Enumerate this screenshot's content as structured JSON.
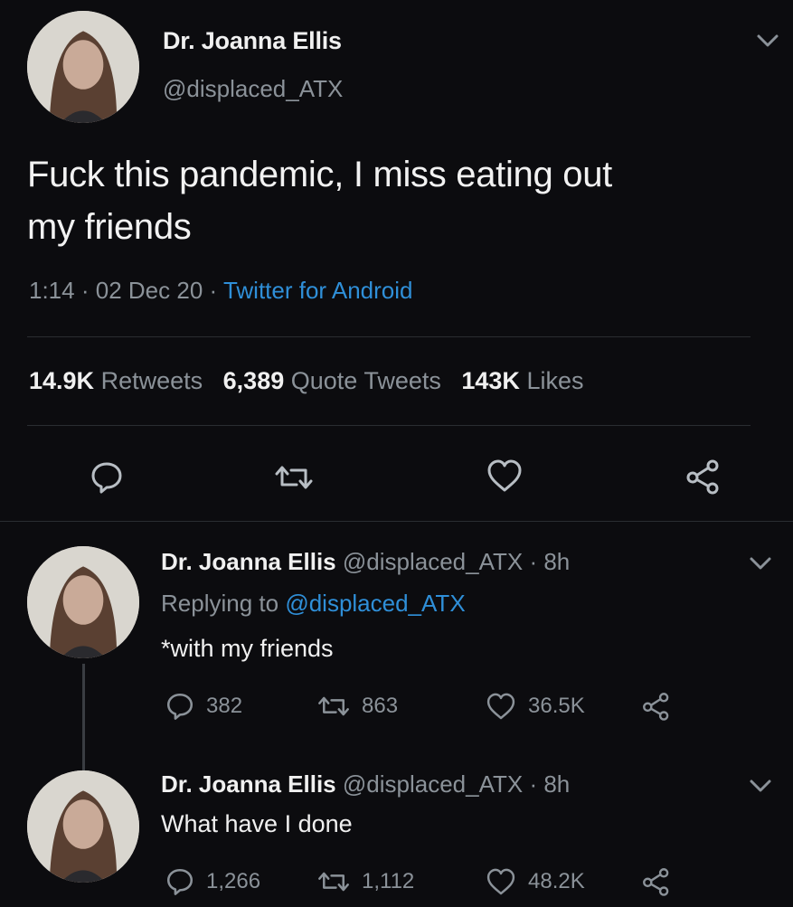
{
  "main_tweet": {
    "name": "Dr. Joanna Ellis",
    "handle": "@displaced_ATX",
    "text_line1": "Fuck this pandemic, I miss eating out",
    "text_line2": "my friends",
    "time": "1:14",
    "date": "02 Dec 20",
    "sep": "·",
    "source": "Twitter for Android",
    "retweets_count": "14.9K",
    "retweets_label": "Retweets",
    "quotes_count": "6,389",
    "quotes_label": "Quote Tweets",
    "likes_count": "143K",
    "likes_label": "Likes"
  },
  "replies": [
    {
      "name": "Dr. Joanna Ellis",
      "handle": "@displaced_ATX",
      "time": "· 8h",
      "replying_label": "Replying to",
      "replying_to": "@displaced_ATX",
      "text": "*with my friends",
      "reply_count": "382",
      "retweet_count": "863",
      "like_count": "36.5K"
    },
    {
      "name": "Dr. Joanna Ellis",
      "handle": "@displaced_ATX",
      "time": "· 8h",
      "text": "What have I done",
      "reply_count": "1,266",
      "retweet_count": "1,112",
      "like_count": "48.2K"
    }
  ],
  "colors": {
    "background": "#0c0c0f",
    "accent": "#2f8fd8",
    "muted": "#8b9299"
  },
  "icons": [
    "chevron-down-icon",
    "reply-icon",
    "retweet-icon",
    "like-icon",
    "share-icon"
  ]
}
